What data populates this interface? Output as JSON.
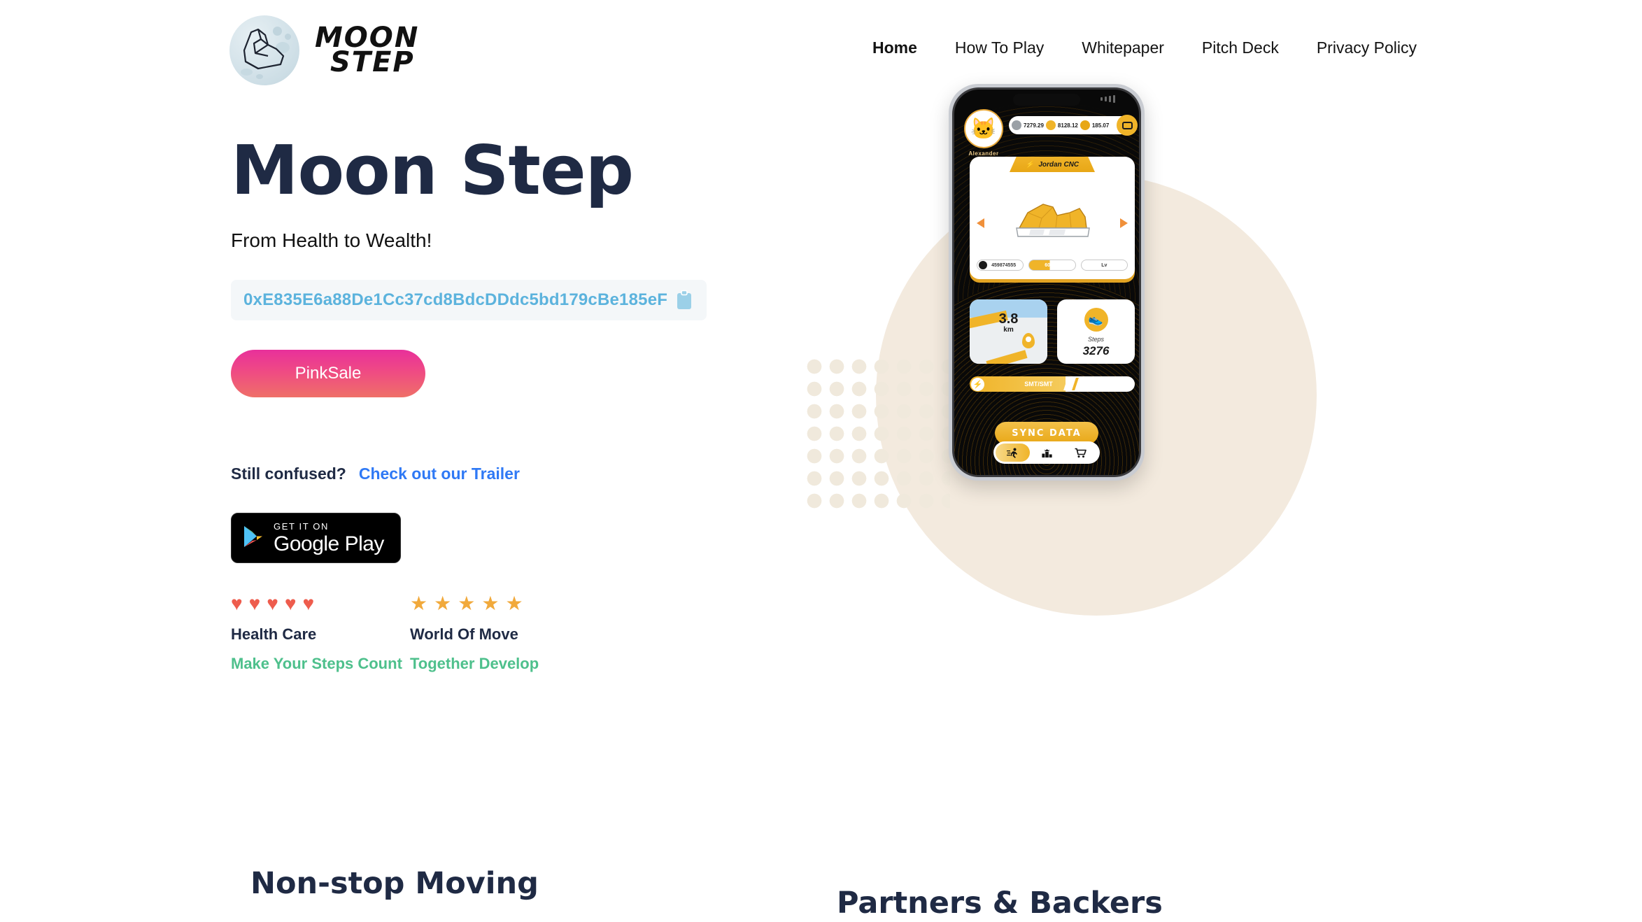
{
  "brand": {
    "line1": "MOON",
    "line2": "STEP",
    "logo_icon": "moon-sneaker-icon"
  },
  "nav": {
    "items": [
      {
        "label": "Home",
        "active": true
      },
      {
        "label": "How To Play",
        "active": false
      },
      {
        "label": "Whitepaper",
        "active": false
      },
      {
        "label": "Pitch Deck",
        "active": false
      },
      {
        "label": "Privacy Policy",
        "active": false
      }
    ]
  },
  "hero": {
    "title": "Moon Step",
    "subtitle": "From Health to Wealth!",
    "contract_address": "0xE835E6a88De1Cc37cd8BdcDDdc5bd179cBe185eF",
    "copy_icon": "clipboard-icon",
    "cta_label": "PinkSale",
    "confused_text": "Still confused?",
    "trailer_link": "Check out our Trailer",
    "google_play": {
      "small_label": "GET IT ON",
      "big_label": "Google Play",
      "icon": "google-play-triangle-icon"
    },
    "features": [
      {
        "icon": "heart-icon",
        "icon_glyph": "♥",
        "icon_count": 5,
        "icon_color": "#ee5c4d",
        "title": "Health Care",
        "subtitle": "Make Your Steps Count"
      },
      {
        "icon": "star-icon",
        "icon_glyph": "★",
        "icon_count": 5,
        "icon_color": "#f1a93b",
        "title": "World Of Move",
        "subtitle": "Together Develop"
      }
    ]
  },
  "phone": {
    "profile_name": "Alexander",
    "avatar_icon": "cat-avatar-icon",
    "stats": [
      {
        "icon": "gray-token-icon",
        "value": "7279.29",
        "color": "#9aa0a6"
      },
      {
        "icon": "energy-bolt-icon",
        "value": "8128.12",
        "color": "#f0b429"
      },
      {
        "icon": "gold-coin-icon",
        "value": "185.07",
        "color": "#e8a716"
      }
    ],
    "wallet_icon": "wallet-icon",
    "shoe_tab_label": "Jordan CNC",
    "shoe_tab_icon": "bolt-icon",
    "shoe_icon": "sneaker-nft-icon",
    "arrow_left_icon": "chevron-left-icon",
    "arrow_right_icon": "chevron-right-icon",
    "pills": [
      {
        "name": "serial-pill",
        "value": "459874555"
      },
      {
        "name": "durability-pill",
        "value": "60/100"
      },
      {
        "name": "level-pill",
        "value": "Lv"
      }
    ],
    "map_tile": {
      "distance": "3.8",
      "unit": "km",
      "pin_icon": "map-pin-icon"
    },
    "steps_tile": {
      "icon": "shoe-step-icon",
      "label": "Steps",
      "value": "3276"
    },
    "token_bar": {
      "label": "SMT/SMT",
      "icon": "energy-bolt-icon"
    },
    "sync_label": "SYNC DATA",
    "tabbar": [
      {
        "name": "tab-run",
        "icon": "running-person-icon",
        "glyph": "🏃",
        "active": true
      },
      {
        "name": "tab-leaderboard",
        "icon": "podium-icon",
        "glyph": "",
        "active": false
      },
      {
        "name": "tab-shop",
        "icon": "shopping-cart-icon",
        "glyph": "🛒",
        "active": false
      }
    ]
  },
  "sections": {
    "left_heading": "Non-stop Moving",
    "right_heading": "Partners & Backers"
  },
  "colors": {
    "ink": "#1f2a44",
    "link": "#2f79f5",
    "green": "#4ec08c",
    "address": "#5cb3dd",
    "pink_from": "#e8309b",
    "pink_to": "#ef6f68",
    "gold": "#f0b429",
    "beige": "#f3eade"
  }
}
